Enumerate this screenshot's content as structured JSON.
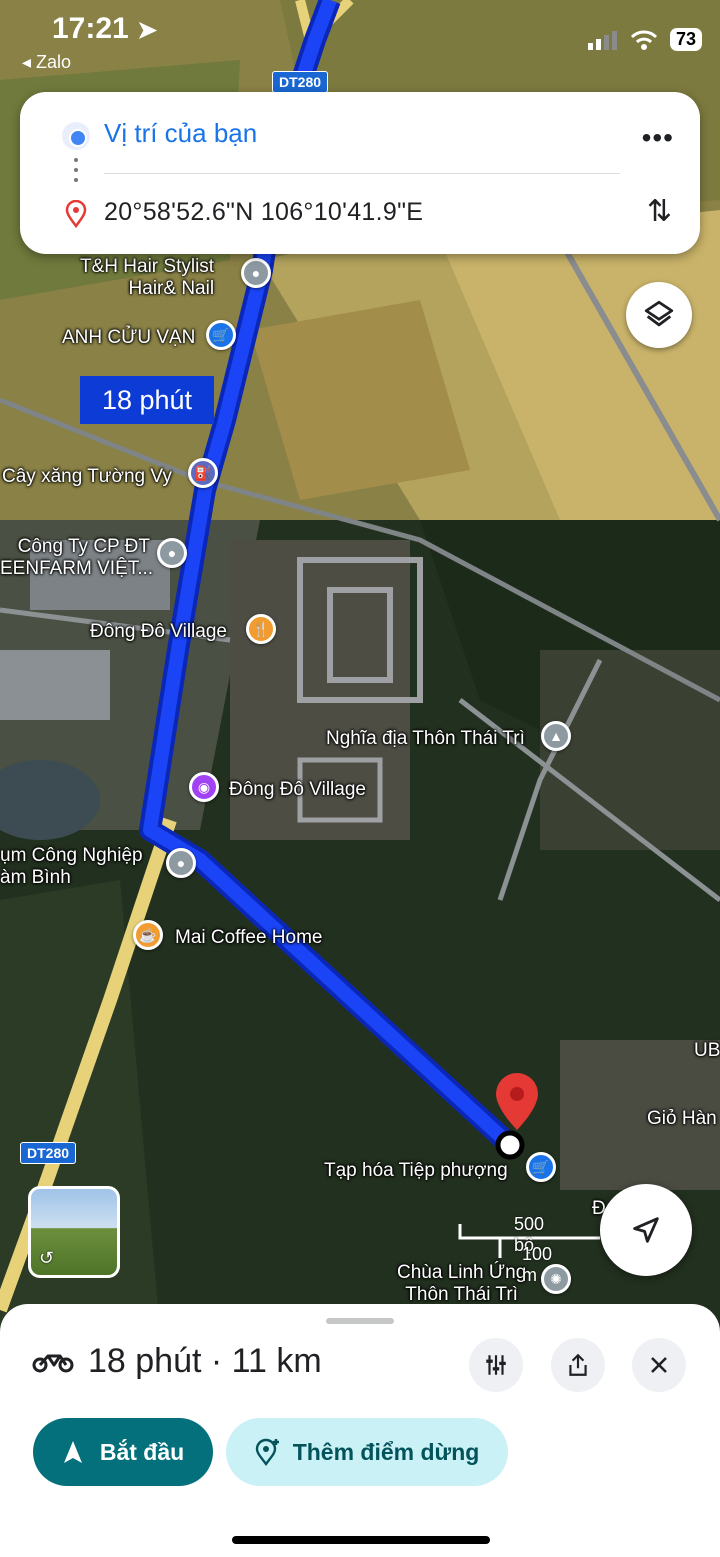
{
  "status_bar": {
    "time": "17:21",
    "back_app": "◂ Zalo",
    "battery": "73"
  },
  "route": {
    "origin": "Vị trí của bạn",
    "destination": "20°58'52.6\"N 106°10'41.9\"E"
  },
  "map": {
    "route_time_tag": "18 phút",
    "road_badge_top": "DT280",
    "road_badge_left": "DT280",
    "labels": {
      "th_hair": "T&H Hair Stylist\nHair& Nail",
      "anh_cuu_van": "ANH CỬU VẠN",
      "cay_xang": "Cây xăng Tường Vy",
      "cong_ty": "Công Ty CP ĐT\nEENFARM VIỆT...",
      "dong_do_village_1": "Đông Đô Village",
      "nghia_dia": "Nghĩa địa Thôn Thái Trì",
      "dong_do_village_2": "Đông Đô Village",
      "cum_cong_nghiep": "ụm Công Nghiệp\nàm Bình",
      "mai_coffee": "Mai Coffee Home",
      "ub": "UB",
      "gio_hang": "Giỏ Hàn",
      "tap_hoa": "Tạp hóa Tiệp phượng",
      "d_tri": "Đ         Tri",
      "chua": "Chùa Linh Ứng\nThôn Thái Trì"
    },
    "scale": {
      "feet": "500 bộ",
      "meters": "100 m"
    },
    "colors": {
      "route": "#1a44f5",
      "route_edge": "#0b27b8",
      "destination_pin": "#e53935"
    }
  },
  "sheet": {
    "summary": "18 phút · 11 km",
    "start_label": "Bắt đầu",
    "add_stop_label": "Thêm điểm dừng"
  },
  "icons": [
    "location-arrow-icon",
    "signal-icon",
    "wifi-icon",
    "more-icon",
    "swap-icon",
    "layers-icon",
    "motorbike-icon",
    "filter-icon",
    "share-icon",
    "close-icon",
    "navigation-icon",
    "add-stop-icon",
    "my-location-icon",
    "street-view-icon"
  ]
}
